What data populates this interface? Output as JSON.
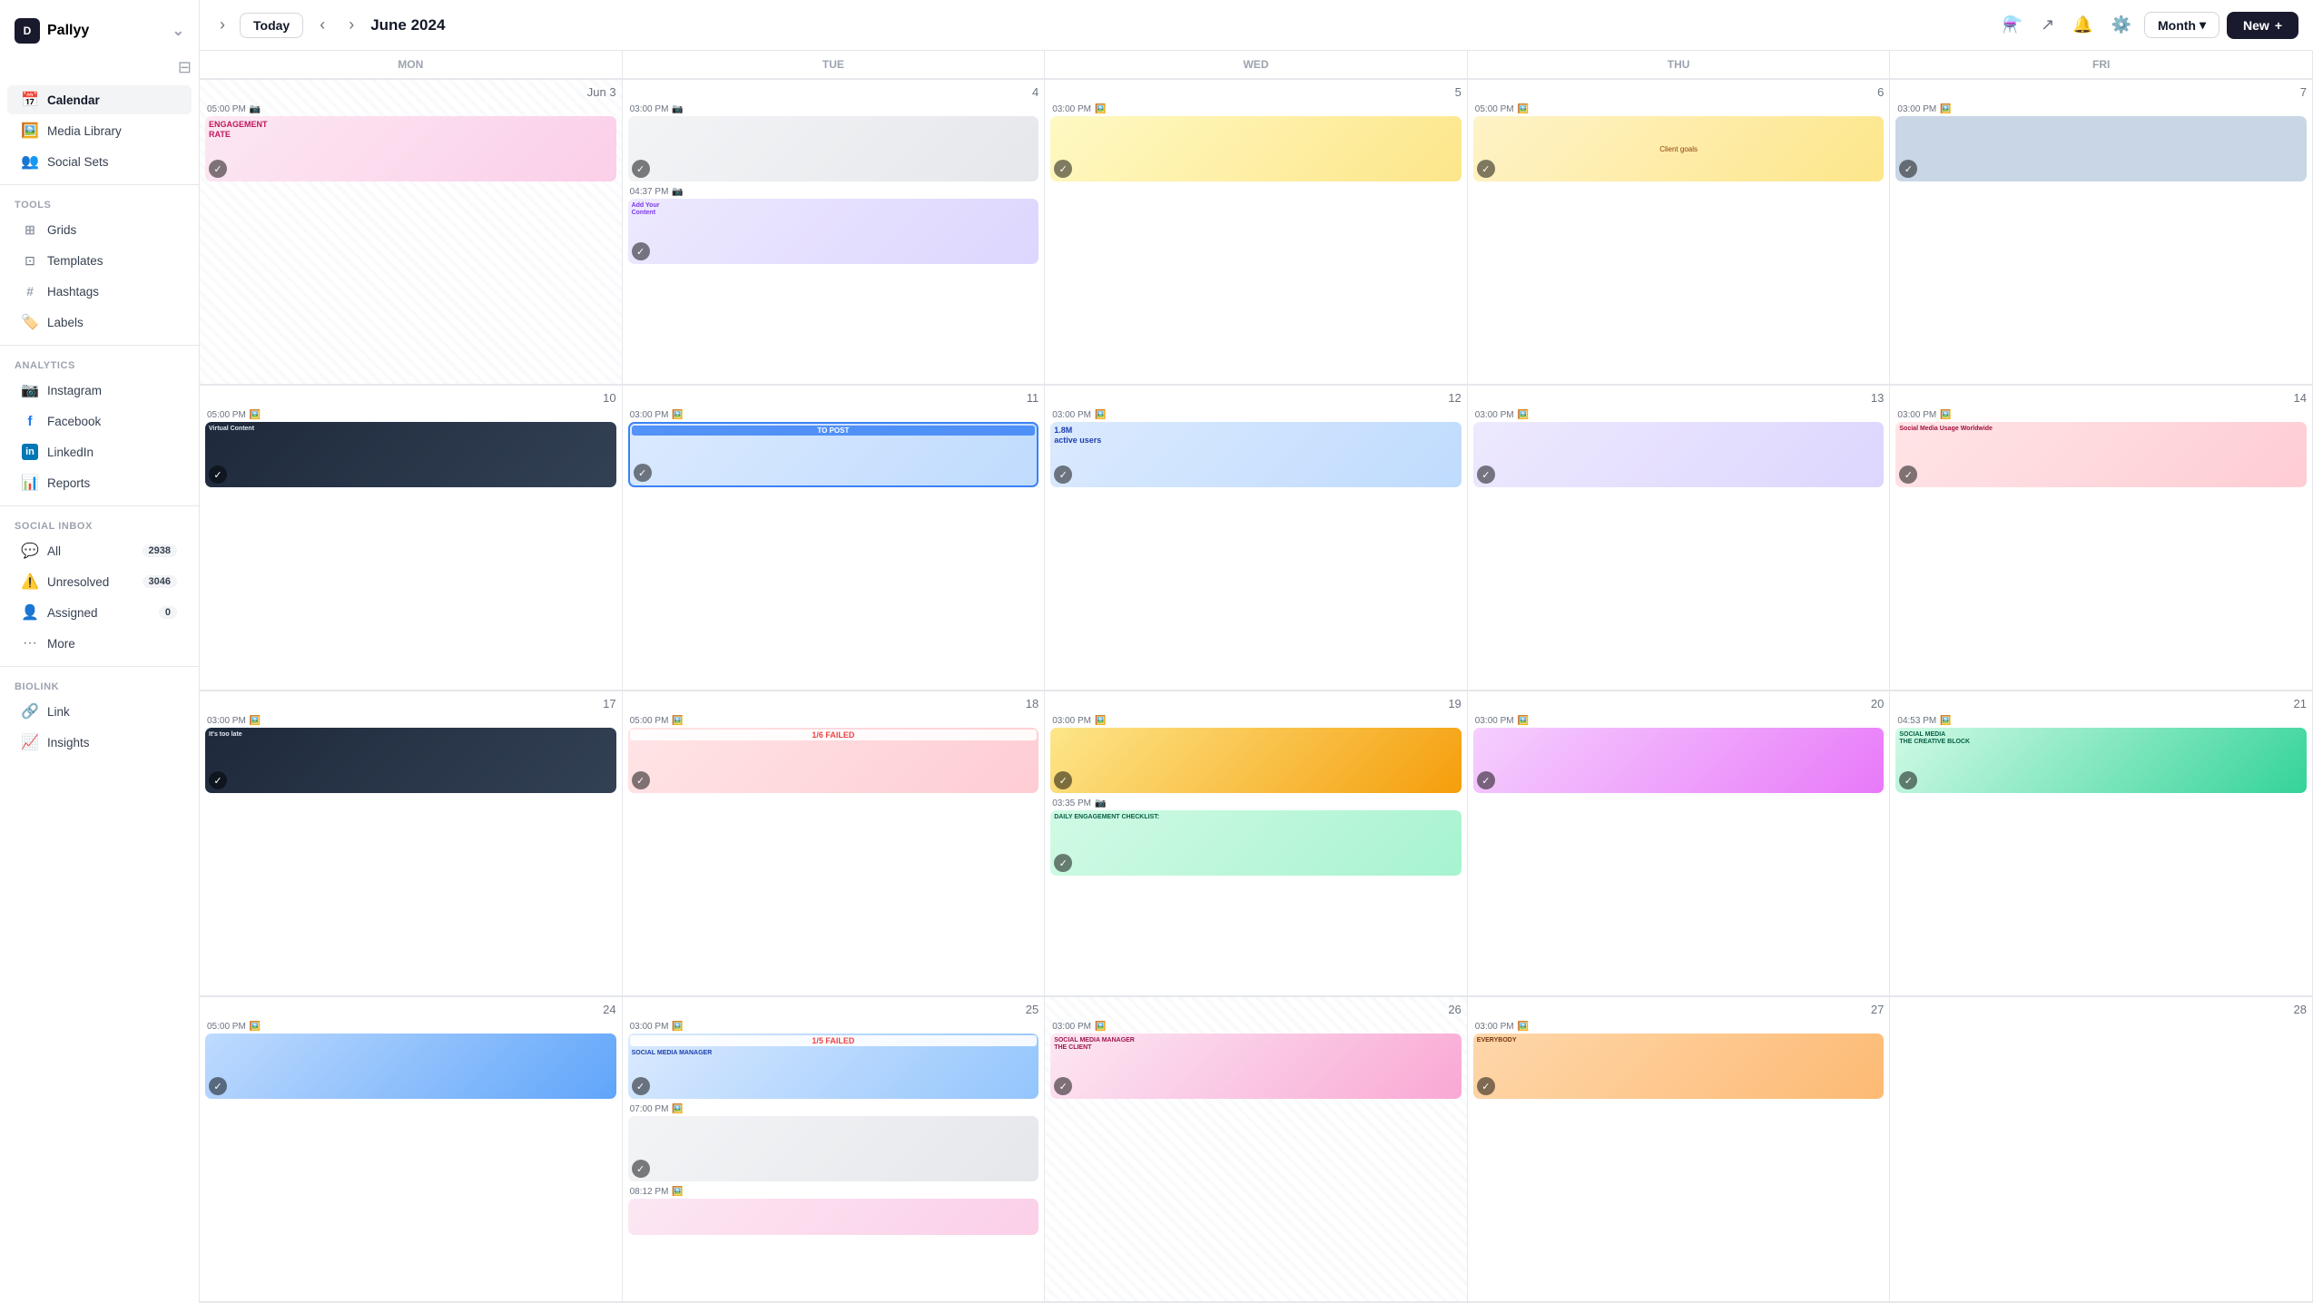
{
  "app": {
    "name": "Pallyy",
    "logo_text": "D"
  },
  "sidebar": {
    "main_items": [
      {
        "id": "calendar",
        "label": "Calendar",
        "icon": "📅",
        "active": true
      },
      {
        "id": "media-library",
        "label": "Media Library",
        "icon": "🖼️"
      },
      {
        "id": "social-sets",
        "label": "Social Sets",
        "icon": "👥"
      }
    ],
    "tools_label": "Tools",
    "tools_items": [
      {
        "id": "grids",
        "label": "Grids",
        "icon": "#"
      },
      {
        "id": "templates",
        "label": "Templates",
        "icon": "⊞"
      },
      {
        "id": "hashtags",
        "label": "Hashtags",
        "icon": "#"
      },
      {
        "id": "labels",
        "label": "Labels",
        "icon": "🏷️"
      }
    ],
    "analytics_label": "Analytics",
    "analytics_items": [
      {
        "id": "instagram",
        "label": "Instagram",
        "icon": "📷"
      },
      {
        "id": "facebook",
        "label": "Facebook",
        "icon": "f"
      },
      {
        "id": "linkedin",
        "label": "LinkedIn",
        "icon": "in"
      },
      {
        "id": "reports",
        "label": "Reports",
        "icon": "📊"
      }
    ],
    "social_inbox_label": "Social Inbox",
    "inbox_items": [
      {
        "id": "all",
        "label": "All",
        "icon": "💬",
        "badge": "2938"
      },
      {
        "id": "unresolved",
        "label": "Unresolved",
        "icon": "⚠️",
        "badge": "3046"
      },
      {
        "id": "assigned",
        "label": "Assigned",
        "icon": "👤",
        "badge": "0"
      },
      {
        "id": "more",
        "label": "More",
        "icon": "···"
      }
    ],
    "biolink_label": "Biolink",
    "biolink_items": [
      {
        "id": "link",
        "label": "Link",
        "icon": "🔗"
      },
      {
        "id": "insights",
        "label": "Insights",
        "icon": "📈"
      }
    ]
  },
  "header": {
    "today_label": "Today",
    "month_label": "Month",
    "new_label": "New",
    "title": "June 2024"
  },
  "calendar": {
    "headers": [
      {
        "day": "MON",
        "col": 0
      },
      {
        "day": "TUE",
        "col": 1
      },
      {
        "day": "WED",
        "col": 2
      },
      {
        "day": "THU",
        "col": 3
      },
      {
        "day": "FRI",
        "col": 4
      }
    ],
    "weeks": [
      {
        "days": [
          {
            "num": "Jun 3",
            "other": true,
            "posts": [
              {
                "time": "05:00 PM",
                "color": "img-pink",
                "label": "ENGAGEMENT RATE",
                "check": true,
                "icon": "📷"
              }
            ]
          },
          {
            "num": "4",
            "posts": [
              {
                "time": "03:00 PM",
                "color": "img-gray",
                "label": "",
                "check": true,
                "icon": "📷"
              },
              {
                "time": "04:37 PM",
                "color": "img-purple",
                "label": "",
                "check": true,
                "icon": "📷"
              }
            ]
          },
          {
            "num": "5",
            "posts": [
              {
                "time": "03:00 PM",
                "color": "img-yellow",
                "label": "",
                "check": true,
                "icon": "🖼️"
              }
            ]
          },
          {
            "num": "6",
            "posts": [
              {
                "time": "05:00 PM",
                "color": "img-yellow",
                "label": "",
                "check": true,
                "icon": "🖼️"
              }
            ]
          },
          {
            "num": "7",
            "posts": [
              {
                "time": "03:00 PM",
                "color": "img-gray",
                "label": "",
                "check": true,
                "icon": "🖼️"
              }
            ]
          }
        ]
      },
      {
        "days": [
          {
            "num": "10",
            "posts": [
              {
                "time": "05:00 PM",
                "color": "img-dark",
                "label": "",
                "check": true,
                "icon": "🖼️"
              }
            ]
          },
          {
            "num": "11",
            "posts": [
              {
                "time": "03:00 PM",
                "color": "img-blue",
                "label": "TO POST",
                "status": "to-post",
                "check": true,
                "icon": "🖼️"
              }
            ]
          },
          {
            "num": "12",
            "posts": [
              {
                "time": "03:00 PM",
                "color": "img-blue",
                "label": "1.8M active users",
                "check": true,
                "icon": "🖼️"
              }
            ]
          },
          {
            "num": "13",
            "posts": [
              {
                "time": "03:00 PM",
                "color": "img-purple",
                "label": "",
                "check": true,
                "icon": "🖼️"
              }
            ]
          },
          {
            "num": "14",
            "posts": [
              {
                "time": "03:00 PM",
                "color": "img-rose",
                "label": "Social Media Usage Worldwide",
                "check": true,
                "icon": "🖼️"
              }
            ]
          }
        ]
      },
      {
        "days": [
          {
            "num": "17",
            "posts": [
              {
                "time": "03:00 PM",
                "color": "img-dark",
                "label": "",
                "check": true,
                "icon": "🖼️"
              }
            ]
          },
          {
            "num": "18",
            "posts": [
              {
                "time": "05:00 PM",
                "color": "img-rose",
                "label": "1/6 FAILED",
                "status": "failed",
                "check": true,
                "icon": "🖼️"
              }
            ]
          },
          {
            "num": "19",
            "posts": [
              {
                "time": "03:00 PM",
                "color": "img-yellow",
                "label": "",
                "check": true,
                "icon": "🖼️"
              },
              {
                "time": "03:35 PM",
                "color": "img-green",
                "label": "DAILY ENGAGEMENT CHECKLIST:",
                "check": true,
                "icon": "📷"
              }
            ]
          },
          {
            "num": "20",
            "posts": [
              {
                "time": "03:00 PM",
                "color": "img-purple",
                "label": "",
                "check": true,
                "icon": "🖼️"
              }
            ]
          },
          {
            "num": "21",
            "posts": [
              {
                "time": "04:53 PM",
                "color": "img-green",
                "label": "SOCIAL MEDIA THE CREATIVE BLOCK",
                "check": true,
                "icon": "🖼️"
              }
            ]
          }
        ]
      },
      {
        "days": [
          {
            "num": "24",
            "posts": [
              {
                "time": "05:00 PM",
                "color": "img-blue",
                "label": "",
                "check": true,
                "icon": "🖼️"
              }
            ]
          },
          {
            "num": "25",
            "posts": [
              {
                "time": "03:00 PM",
                "color": "img-blue",
                "label": "1/5 FAILED SOCIAL MEDIA MANAGER",
                "status": "failed",
                "check": true,
                "icon": "🖼️"
              },
              {
                "time": "07:00 PM",
                "color": "img-gray",
                "label": "",
                "check": true,
                "icon": "🖼️"
              },
              {
                "time": "08:12 PM",
                "color": "img-pink",
                "label": "",
                "check": false,
                "icon": "🖼️"
              }
            ]
          },
          {
            "num": "26",
            "posts": [
              {
                "time": "03:00 PM",
                "color": "img-pink",
                "label": "SOCIAL MEDIA MANAGER THE CLIENT",
                "check": true,
                "icon": "🖼️",
                "stripe": true
              }
            ]
          },
          {
            "num": "27",
            "posts": [
              {
                "time": "03:00 PM",
                "color": "img-orange",
                "label": "",
                "check": true,
                "icon": "🖼️"
              }
            ]
          },
          {
            "num": "28",
            "posts": []
          }
        ]
      }
    ]
  }
}
